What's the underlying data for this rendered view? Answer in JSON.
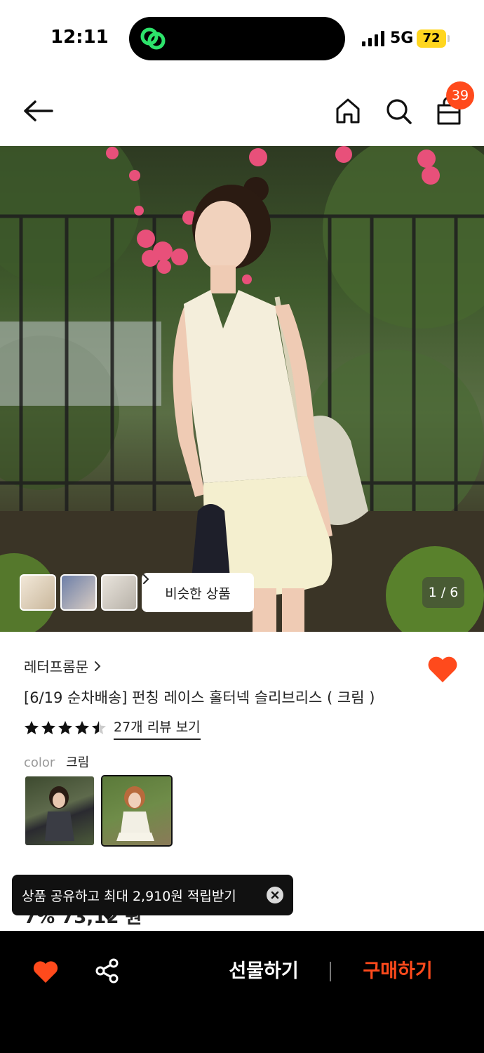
{
  "status_bar": {
    "time": "12:11",
    "network": "5G",
    "battery": "72"
  },
  "header": {
    "cart_count": "39"
  },
  "gallery": {
    "similar_label": "비슷한 상품",
    "pager": "1 / 6"
  },
  "product": {
    "brand": "레터프롬문",
    "title": "[6/19 순차배송] 펀칭 레이스 홀터넥 슬리브리스 ( 크림 )",
    "rating": 4.5,
    "review_link": "27개 리뷰 보기",
    "option_label": "color",
    "option_value": "크림",
    "price_peek": "7% 73,12 원"
  },
  "toast": {
    "text": "상품 공유하고 최대 2,910원 적립받기"
  },
  "bottom_bar": {
    "gift_label": "선물하기",
    "buy_label": "구매하기"
  },
  "colors": {
    "accent": "#ff4a1c",
    "badge_yellow": "#ffd61f",
    "island_green": "#2de36b"
  }
}
